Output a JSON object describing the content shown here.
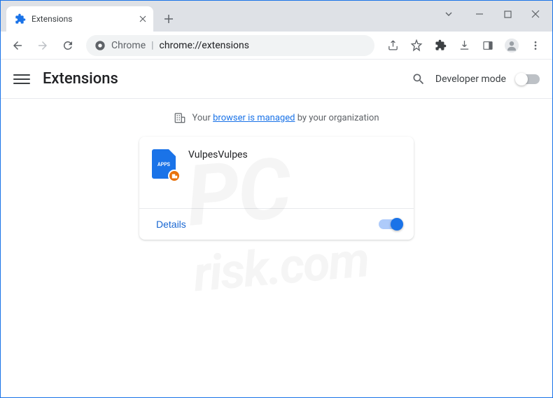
{
  "tab": {
    "title": "Extensions"
  },
  "omnibox": {
    "prefix": "Chrome",
    "url": "chrome://extensions"
  },
  "header": {
    "title": "Extensions",
    "dev_mode_label": "Developer mode"
  },
  "managed": {
    "prefix": "Your",
    "link": "browser is managed",
    "suffix": "by your organization"
  },
  "extension": {
    "icon_label": "APPS",
    "name": "VulpesVulpes",
    "details_label": "Details"
  },
  "watermark": {
    "line1": "PC",
    "line2": "risk.com"
  }
}
